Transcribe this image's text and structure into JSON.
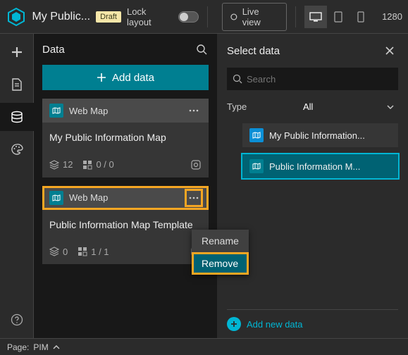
{
  "topbar": {
    "app_title": "My Public...",
    "draft_badge": "Draft",
    "lock_label": "Lock layout",
    "live_view": "Live view",
    "resolution": "1280"
  },
  "data_panel": {
    "title": "Data",
    "add_button": "Add data",
    "cards": [
      {
        "type_label": "Web Map",
        "title": "My Public Information Map",
        "layers_count": "12",
        "widgets_count": "0 / 0"
      },
      {
        "type_label": "Web Map",
        "title": "Public Information Map Template",
        "layers_count": "0",
        "widgets_count": "1 / 1"
      }
    ]
  },
  "context_menu": {
    "rename": "Rename",
    "remove": "Remove"
  },
  "select_panel": {
    "title": "Select data",
    "search_placeholder": "Search",
    "type_label": "Type",
    "type_value": "All",
    "items": [
      {
        "label": "My Public Information..."
      },
      {
        "label": "Public Information M..."
      }
    ],
    "add_new": "Add new data"
  },
  "footer": {
    "page_label": "Page:",
    "page_name": "PIM"
  }
}
